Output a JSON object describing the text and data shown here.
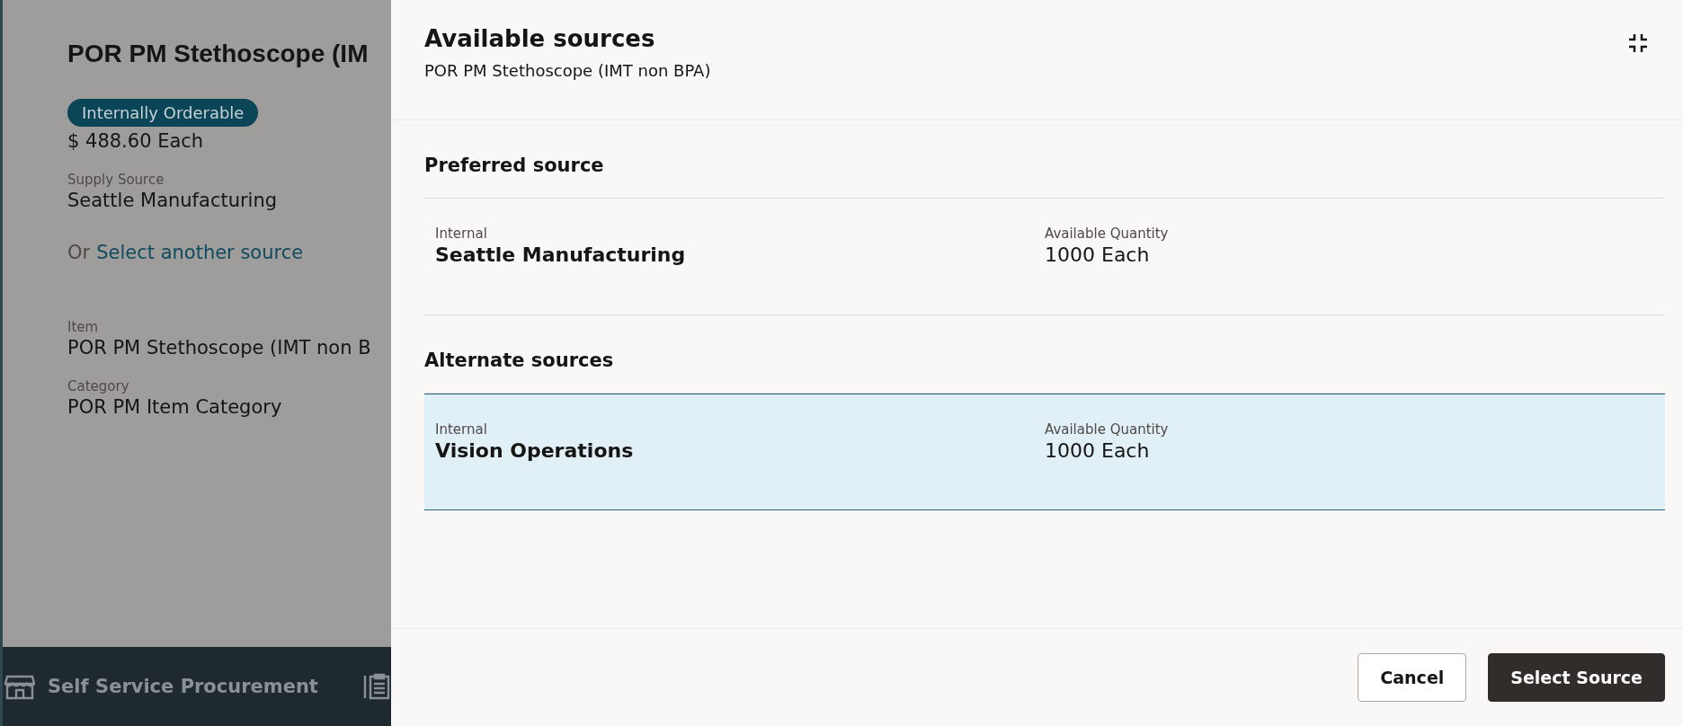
{
  "background_page": {
    "title": "POR PM Stethoscope (IM",
    "badge": "Internally Orderable",
    "price": "$ 488.60 Each",
    "supply_source": {
      "label": "Supply Source",
      "value": "Seattle Manufacturing"
    },
    "source_prompt": {
      "prefix": "Or",
      "link": "Select another source"
    },
    "fields": [
      {
        "label": "Item",
        "value": "POR PM Stethoscope (IMT non B"
      },
      {
        "label": "Category",
        "value": "POR PM Item Category"
      }
    ]
  },
  "bottom_nav": [
    {
      "label": "Self Service Procurement",
      "kind": "store"
    },
    {
      "kind": "clipboard"
    }
  ],
  "drawer": {
    "title": "Available sources",
    "subtitle": "POR PM Stethoscope (IMT non BPA)",
    "sections": [
      {
        "heading": "Preferred source",
        "sources": [
          {
            "type": "Internal",
            "name": "Seattle Manufacturing",
            "quantity_label": "Available Quantity",
            "quantity": "1000 Each",
            "selected": false
          }
        ]
      },
      {
        "heading": "Alternate sources",
        "sources": [
          {
            "type": "Internal",
            "name": "Vision Operations",
            "quantity_label": "Available Quantity",
            "quantity": "1000 Each",
            "selected": true
          }
        ]
      }
    ],
    "buttons": [
      {
        "label": "Cancel",
        "kind": "secondary"
      },
      {
        "label": "Select Source",
        "kind": "primary"
      }
    ]
  }
}
